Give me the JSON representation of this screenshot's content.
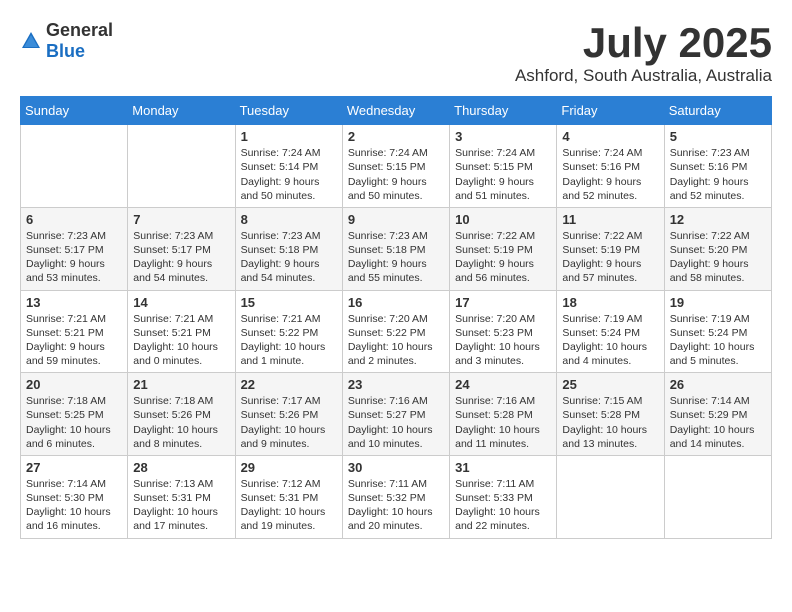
{
  "logo": {
    "general": "General",
    "blue": "Blue"
  },
  "title": {
    "month": "July 2025",
    "location": "Ashford, South Australia, Australia"
  },
  "weekdays": [
    "Sunday",
    "Monday",
    "Tuesday",
    "Wednesday",
    "Thursday",
    "Friday",
    "Saturday"
  ],
  "weeks": [
    [
      {
        "day": "",
        "detail": ""
      },
      {
        "day": "",
        "detail": ""
      },
      {
        "day": "1",
        "detail": "Sunrise: 7:24 AM\nSunset: 5:14 PM\nDaylight: 9 hours and 50 minutes."
      },
      {
        "day": "2",
        "detail": "Sunrise: 7:24 AM\nSunset: 5:15 PM\nDaylight: 9 hours and 50 minutes."
      },
      {
        "day": "3",
        "detail": "Sunrise: 7:24 AM\nSunset: 5:15 PM\nDaylight: 9 hours and 51 minutes."
      },
      {
        "day": "4",
        "detail": "Sunrise: 7:24 AM\nSunset: 5:16 PM\nDaylight: 9 hours and 52 minutes."
      },
      {
        "day": "5",
        "detail": "Sunrise: 7:23 AM\nSunset: 5:16 PM\nDaylight: 9 hours and 52 minutes."
      }
    ],
    [
      {
        "day": "6",
        "detail": "Sunrise: 7:23 AM\nSunset: 5:17 PM\nDaylight: 9 hours and 53 minutes."
      },
      {
        "day": "7",
        "detail": "Sunrise: 7:23 AM\nSunset: 5:17 PM\nDaylight: 9 hours and 54 minutes."
      },
      {
        "day": "8",
        "detail": "Sunrise: 7:23 AM\nSunset: 5:18 PM\nDaylight: 9 hours and 54 minutes."
      },
      {
        "day": "9",
        "detail": "Sunrise: 7:23 AM\nSunset: 5:18 PM\nDaylight: 9 hours and 55 minutes."
      },
      {
        "day": "10",
        "detail": "Sunrise: 7:22 AM\nSunset: 5:19 PM\nDaylight: 9 hours and 56 minutes."
      },
      {
        "day": "11",
        "detail": "Sunrise: 7:22 AM\nSunset: 5:19 PM\nDaylight: 9 hours and 57 minutes."
      },
      {
        "day": "12",
        "detail": "Sunrise: 7:22 AM\nSunset: 5:20 PM\nDaylight: 9 hours and 58 minutes."
      }
    ],
    [
      {
        "day": "13",
        "detail": "Sunrise: 7:21 AM\nSunset: 5:21 PM\nDaylight: 9 hours and 59 minutes."
      },
      {
        "day": "14",
        "detail": "Sunrise: 7:21 AM\nSunset: 5:21 PM\nDaylight: 10 hours and 0 minutes."
      },
      {
        "day": "15",
        "detail": "Sunrise: 7:21 AM\nSunset: 5:22 PM\nDaylight: 10 hours and 1 minute."
      },
      {
        "day": "16",
        "detail": "Sunrise: 7:20 AM\nSunset: 5:22 PM\nDaylight: 10 hours and 2 minutes."
      },
      {
        "day": "17",
        "detail": "Sunrise: 7:20 AM\nSunset: 5:23 PM\nDaylight: 10 hours and 3 minutes."
      },
      {
        "day": "18",
        "detail": "Sunrise: 7:19 AM\nSunset: 5:24 PM\nDaylight: 10 hours and 4 minutes."
      },
      {
        "day": "19",
        "detail": "Sunrise: 7:19 AM\nSunset: 5:24 PM\nDaylight: 10 hours and 5 minutes."
      }
    ],
    [
      {
        "day": "20",
        "detail": "Sunrise: 7:18 AM\nSunset: 5:25 PM\nDaylight: 10 hours and 6 minutes."
      },
      {
        "day": "21",
        "detail": "Sunrise: 7:18 AM\nSunset: 5:26 PM\nDaylight: 10 hours and 8 minutes."
      },
      {
        "day": "22",
        "detail": "Sunrise: 7:17 AM\nSunset: 5:26 PM\nDaylight: 10 hours and 9 minutes."
      },
      {
        "day": "23",
        "detail": "Sunrise: 7:16 AM\nSunset: 5:27 PM\nDaylight: 10 hours and 10 minutes."
      },
      {
        "day": "24",
        "detail": "Sunrise: 7:16 AM\nSunset: 5:28 PM\nDaylight: 10 hours and 11 minutes."
      },
      {
        "day": "25",
        "detail": "Sunrise: 7:15 AM\nSunset: 5:28 PM\nDaylight: 10 hours and 13 minutes."
      },
      {
        "day": "26",
        "detail": "Sunrise: 7:14 AM\nSunset: 5:29 PM\nDaylight: 10 hours and 14 minutes."
      }
    ],
    [
      {
        "day": "27",
        "detail": "Sunrise: 7:14 AM\nSunset: 5:30 PM\nDaylight: 10 hours and 16 minutes."
      },
      {
        "day": "28",
        "detail": "Sunrise: 7:13 AM\nSunset: 5:31 PM\nDaylight: 10 hours and 17 minutes."
      },
      {
        "day": "29",
        "detail": "Sunrise: 7:12 AM\nSunset: 5:31 PM\nDaylight: 10 hours and 19 minutes."
      },
      {
        "day": "30",
        "detail": "Sunrise: 7:11 AM\nSunset: 5:32 PM\nDaylight: 10 hours and 20 minutes."
      },
      {
        "day": "31",
        "detail": "Sunrise: 7:11 AM\nSunset: 5:33 PM\nDaylight: 10 hours and 22 minutes."
      },
      {
        "day": "",
        "detail": ""
      },
      {
        "day": "",
        "detail": ""
      }
    ]
  ]
}
